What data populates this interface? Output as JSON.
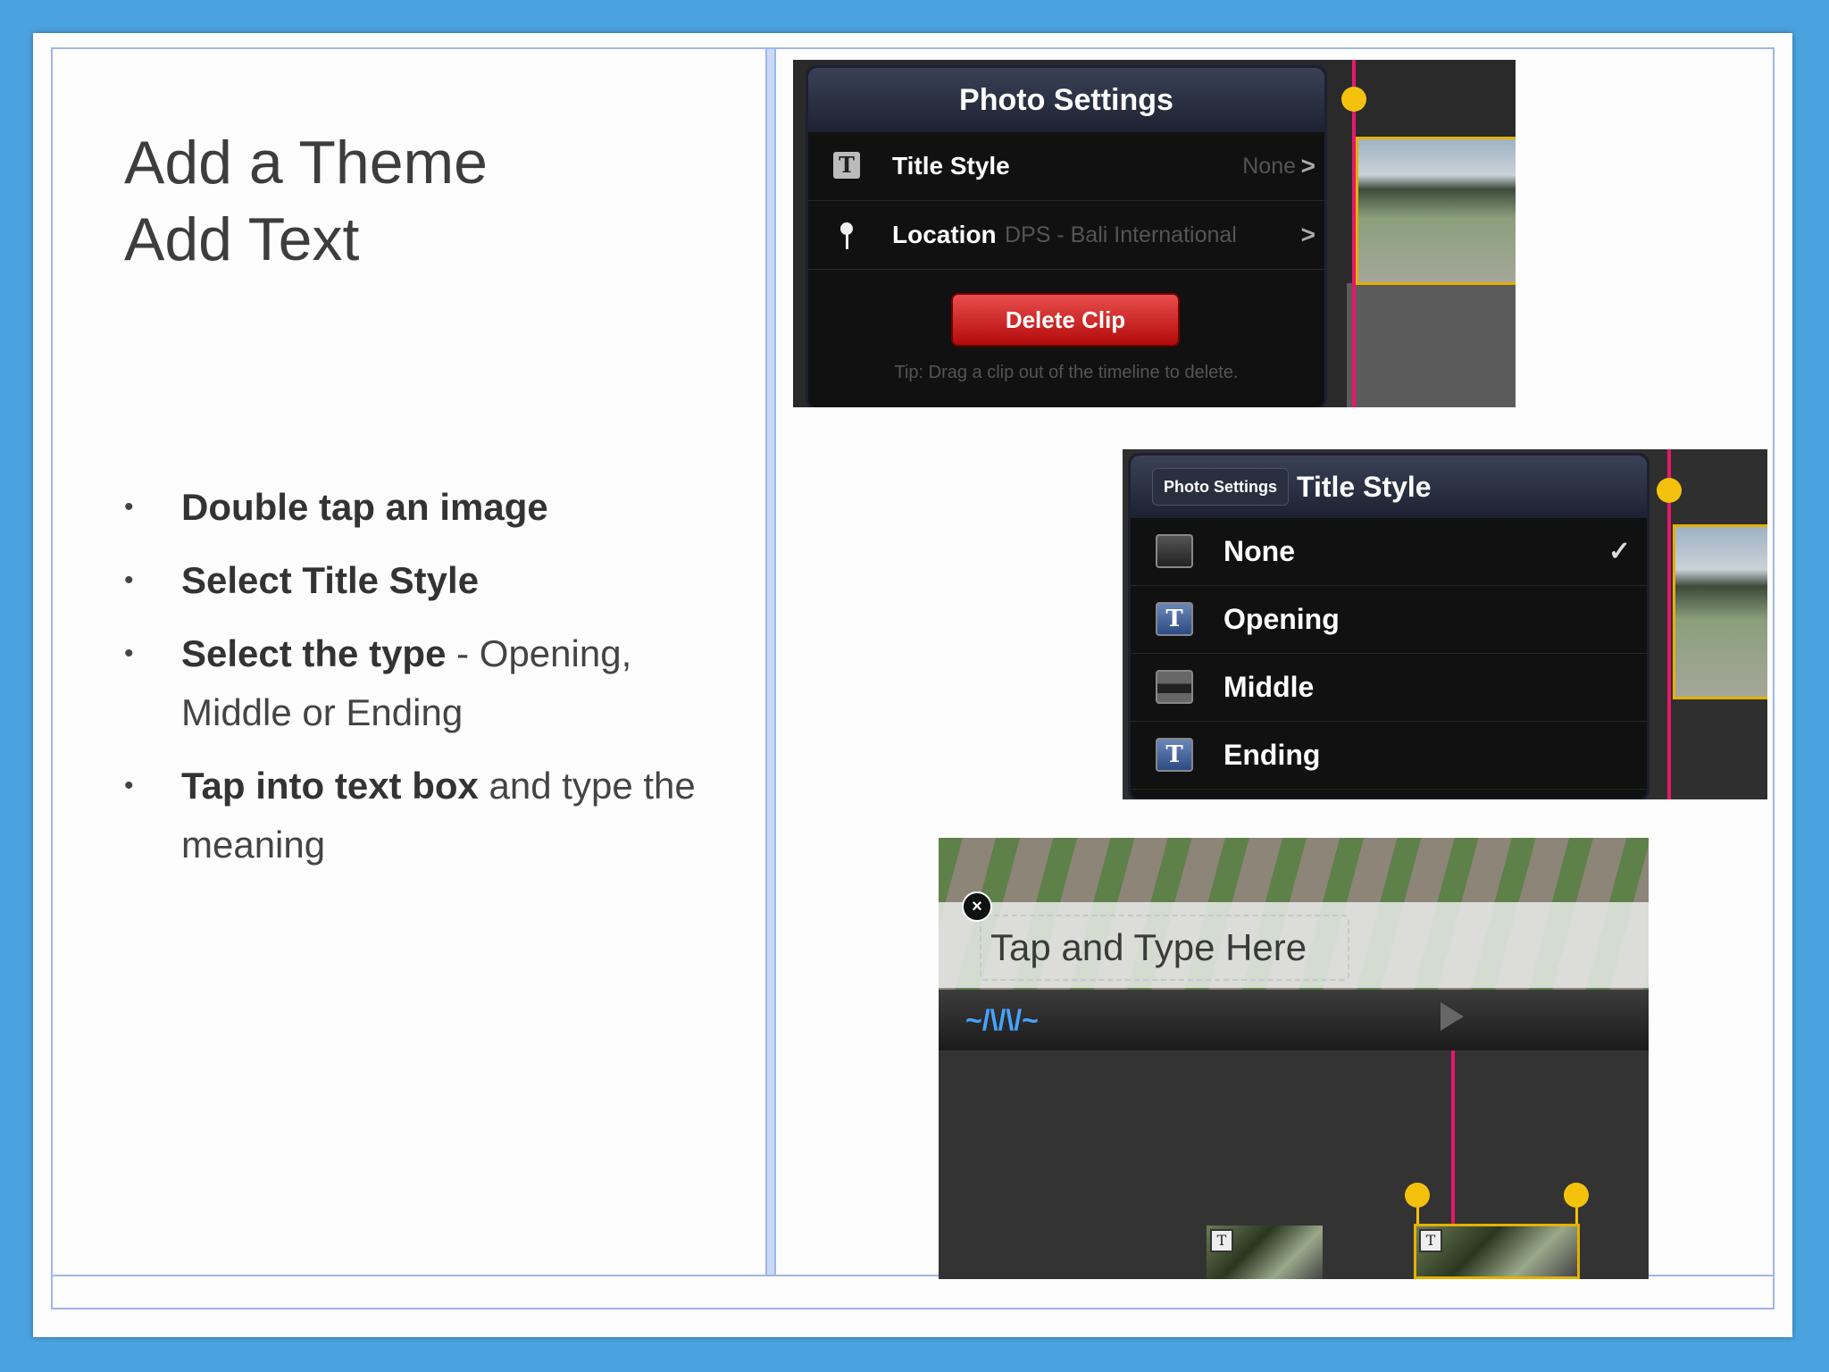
{
  "slide": {
    "title_line1": "Add a Theme",
    "title_line2": "Add Text",
    "bullets": [
      {
        "bold": "Double tap an image",
        "rest": ""
      },
      {
        "bold": "Select Title Style",
        "rest": ""
      },
      {
        "bold": "Select the type",
        "rest": " - Opening, Middle or Ending"
      },
      {
        "bold": "Tap into text box",
        "rest": " and type the meaning"
      }
    ]
  },
  "photo_settings": {
    "title": "Photo Settings",
    "title_style_label": "Title Style",
    "title_style_value": "None",
    "location_label": "Location",
    "location_value": "DPS - Bali International",
    "delete_label": "Delete Clip",
    "tip": "Tip: Drag a clip out of the timeline to delete.",
    "chevron": ">",
    "icon_glyph": "T"
  },
  "title_style_menu": {
    "back_label": "Photo Settings",
    "title": "Title Style",
    "options": [
      "None",
      "Opening",
      "Middle",
      "Ending"
    ],
    "selected": "None",
    "check": "✓",
    "icon_glyph": "T"
  },
  "text_entry": {
    "placeholder": "Tap and Type Here",
    "close_glyph": "×",
    "wave_glyph": "~/\\/\\/~",
    "badge_glyph": "T"
  },
  "colors": {
    "background": "#4aa3df",
    "accent_frame": "#9fb6e6",
    "playhead": "#e6186a",
    "delete_red": "#d32020",
    "knob": "#f4c20d"
  }
}
